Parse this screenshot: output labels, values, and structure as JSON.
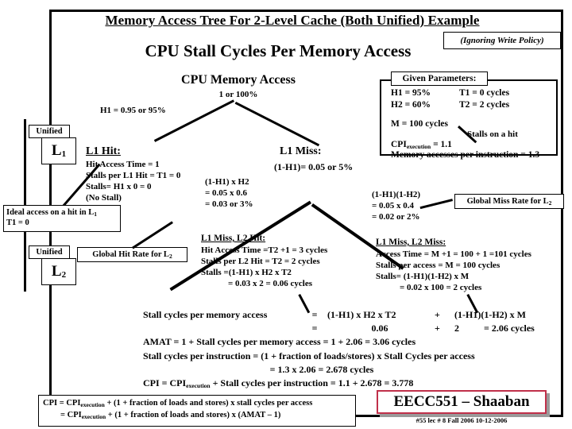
{
  "title": "Memory Access Tree For 2-Level Cache (Both Unified) Example",
  "subtitle": "CPU  Stall Cycles Per Memory Access",
  "ignoring_note": "(Ignoring Write Policy)",
  "root": {
    "label": "CPU Memory  Access",
    "probability": "1 or 100%"
  },
  "edges": {
    "h1_label": "H1 = 0.95 or 95%"
  },
  "given_parameters": {
    "heading": "Given Parameters:",
    "h1": "H1  = 95%",
    "t1": "T1  = 0 cycles",
    "h2": "H2  = 60%",
    "t2": "T2  = 2 cycles",
    "m": "M = 100 cycles",
    "stalls_on_hit": "Stalls on a hit",
    "cpi_exec": "CPI",
    "cpi_exec_sub": "execution",
    "cpi_exec_val": " = 1.1",
    "mem_per_inst": "Memory accesses per instruction = 1.3"
  },
  "cache_blocks": {
    "l1_unified": "Unified",
    "l1_level": "L",
    "l1_level_sub": "1",
    "l2_unified": "Unified",
    "l2_level": "L",
    "l2_level_sub": "2"
  },
  "callouts": {
    "ideal_line1": "Ideal access on a hit in L",
    "ideal_line1_sub": "1",
    "ideal_line2": "T1 = 0",
    "global_hit_rate": "Global Hit Rate for L",
    "global_hit_rate_sub": "2",
    "global_miss_rate": "Global Miss Rate for L",
    "global_miss_rate_sub": "2"
  },
  "l1_hit": {
    "heading": "L1  Hit:",
    "line1": "Hit Access Time = 1",
    "line2": "Stalls per L1 Hit = T1 = 0",
    "line3": "Stalls= H1 x 0 = 0",
    "line4": "(No Stall)"
  },
  "l1_miss": {
    "heading": "L1  Miss:",
    "probability": "(1-H1)= 0.05 or  5%"
  },
  "branch_left": {
    "line1": "(1-H1) x H2",
    "line2": "= 0.05 x 0.6",
    "line3": "= 0.03 or 3%"
  },
  "branch_right": {
    "line1": "(1-H1)(1-H2)",
    "line2": "= 0.05 x 0.4",
    "line3": "=  0.02  or 2%"
  },
  "l1miss_l2hit": {
    "heading": "L1 Miss, L2  Hit:",
    "line1": "Hit Access Time =T2 +1 = 3 cycles",
    "line2": "Stalls per L2 Hit = T2 = 2 cycles",
    "line3": "Stalls =(1-H1) x H2 x T2",
    "line4": "=  0.03 x 2 = 0.06 cycles"
  },
  "l1miss_l2miss": {
    "heading": "L1 Miss, L2   Miss:",
    "line1": "Access Time = M +1 = 100 + 1 =101 cycles",
    "line2": "Stalls per access = M  = 100 cycles",
    "line3": "Stalls=  (1-H1)(1-H2) x M",
    "line4": "= 0.02 x 100 = 2 cycles"
  },
  "calculations": {
    "stall_label": "Stall cycles per memory access",
    "stall_eq1": "=",
    "stall_term1": "(1-H1) x H2 x T2",
    "stall_plus1": "+",
    "stall_term2": "(1-H1)(1-H2) x M",
    "stall_eq2": "=",
    "stall_val1": "0.06",
    "stall_plus2": "+",
    "stall_val2": "2",
    "stall_result": "= 2.06 cycles",
    "amat": "AMAT  =  1  + Stall cycles per memory access  = 1 + 2.06 = 3.06 cycles",
    "spi": "Stall cycles per instruction = (1  + fraction of loads/stores) x Stall Cycles per access",
    "spi_val": "= 1.3 x 2.06 =  2.678  cycles",
    "cpi_pre": "CPI = CPI",
    "cpi_sub": "execution",
    "cpi_post": " + Stall cycles per instruction    =  1.1 + 2.678 =  3.778"
  },
  "cpi_box": {
    "l1_pre": "CPI = CPI",
    "l1_sub": "execution",
    "l1_post": "  +  (1 + fraction of loads and stores) x stall cycles per access",
    "l2_pre": "= CPI",
    "l2_sub": "execution",
    "l2_post": "  +  (1 + fraction of loads and stores) x (AMAT – 1)"
  },
  "footer": {
    "brand": "EECC551 – Shaaban",
    "meta": "#55   lec # 8   Fall 2006  10-12-2006",
    "accent": "#c0304a"
  }
}
